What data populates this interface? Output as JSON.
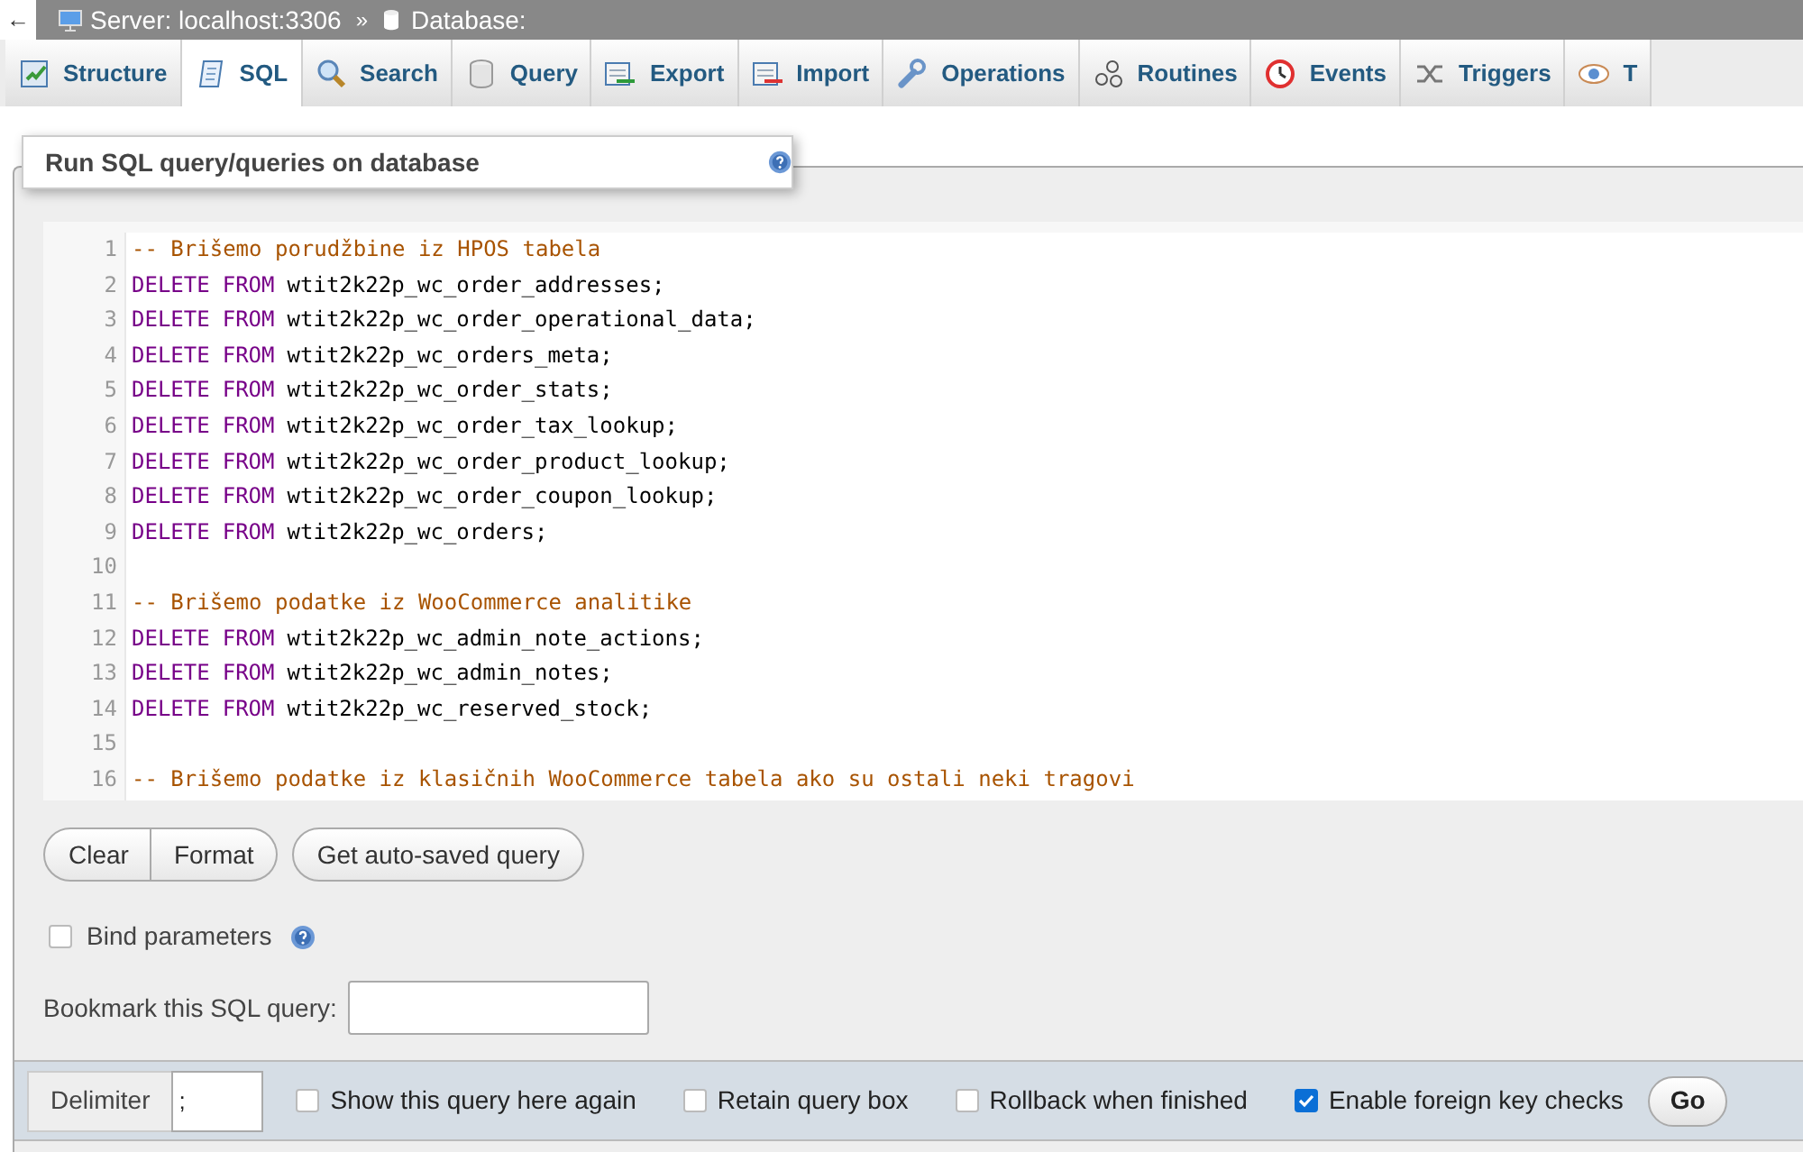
{
  "breadcrumb": {
    "back": "←",
    "server": "Server: localhost:3306",
    "separator": "»",
    "database": "Database:"
  },
  "tabs": [
    {
      "label": "Structure",
      "selected": false
    },
    {
      "label": "SQL",
      "selected": true
    },
    {
      "label": "Search",
      "selected": false
    },
    {
      "label": "Query",
      "selected": false
    },
    {
      "label": "Export",
      "selected": false
    },
    {
      "label": "Import",
      "selected": false
    },
    {
      "label": "Operations",
      "selected": false
    },
    {
      "label": "Routines",
      "selected": false
    },
    {
      "label": "Events",
      "selected": false
    },
    {
      "label": "Triggers",
      "selected": false
    },
    {
      "label": "T",
      "selected": false
    }
  ],
  "legend": "Run SQL query/queries on database",
  "editor": {
    "lines": [
      {
        "number": "1",
        "kind": "comment",
        "text": "-- Brišemo porudžbine iz HPOS tabela"
      },
      {
        "number": "2",
        "kind": "statement",
        "keywords": [
          "DELETE",
          "FROM"
        ],
        "text": "wtit2k22p_wc_order_addresses;"
      },
      {
        "number": "3",
        "kind": "statement",
        "keywords": [
          "DELETE",
          "FROM"
        ],
        "text": "wtit2k22p_wc_order_operational_data;"
      },
      {
        "number": "4",
        "kind": "statement",
        "keywords": [
          "DELETE",
          "FROM"
        ],
        "text": "wtit2k22p_wc_orders_meta;"
      },
      {
        "number": "5",
        "kind": "statement",
        "keywords": [
          "DELETE",
          "FROM"
        ],
        "text": "wtit2k22p_wc_order_stats;"
      },
      {
        "number": "6",
        "kind": "statement",
        "keywords": [
          "DELETE",
          "FROM"
        ],
        "text": "wtit2k22p_wc_order_tax_lookup;"
      },
      {
        "number": "7",
        "kind": "statement",
        "keywords": [
          "DELETE",
          "FROM"
        ],
        "text": "wtit2k22p_wc_order_product_lookup;"
      },
      {
        "number": "8",
        "kind": "statement",
        "keywords": [
          "DELETE",
          "FROM"
        ],
        "text": "wtit2k22p_wc_order_coupon_lookup;"
      },
      {
        "number": "9",
        "kind": "statement",
        "keywords": [
          "DELETE",
          "FROM"
        ],
        "text": "wtit2k22p_wc_orders;"
      },
      {
        "number": "10",
        "kind": "blank"
      },
      {
        "number": "11",
        "kind": "comment",
        "text": "-- Brišemo podatke iz WooCommerce analitike"
      },
      {
        "number": "12",
        "kind": "statement",
        "keywords": [
          "DELETE",
          "FROM"
        ],
        "text": "wtit2k22p_wc_admin_note_actions;"
      },
      {
        "number": "13",
        "kind": "statement",
        "keywords": [
          "DELETE",
          "FROM"
        ],
        "text": "wtit2k22p_wc_admin_notes;"
      },
      {
        "number": "14",
        "kind": "statement",
        "keywords": [
          "DELETE",
          "FROM"
        ],
        "text": "wtit2k22p_wc_reserved_stock;"
      },
      {
        "number": "15",
        "kind": "blank"
      },
      {
        "number": "16",
        "kind": "comment",
        "text": "-- Brišemo podatke iz klasičnih WooCommerce tabela ako su ostali neki tragovi"
      }
    ]
  },
  "button_group": [
    "Clear",
    "Format"
  ],
  "autosave_button": "Get auto-saved query",
  "bind_parameters": {
    "label": "Bind parameters",
    "checked": false
  },
  "bookmark": {
    "label": "Bookmark this SQL query:"
  },
  "footer": {
    "delimiter_label": "Delimiter",
    "delimiter_value": ";",
    "options": [
      {
        "label": "Show this query here again",
        "checked": false
      },
      {
        "label": "Retain query box",
        "checked": false
      },
      {
        "label": "Rollback when finished",
        "checked": false
      },
      {
        "label": "Enable foreign key checks",
        "checked": true
      }
    ],
    "go": "Go"
  }
}
